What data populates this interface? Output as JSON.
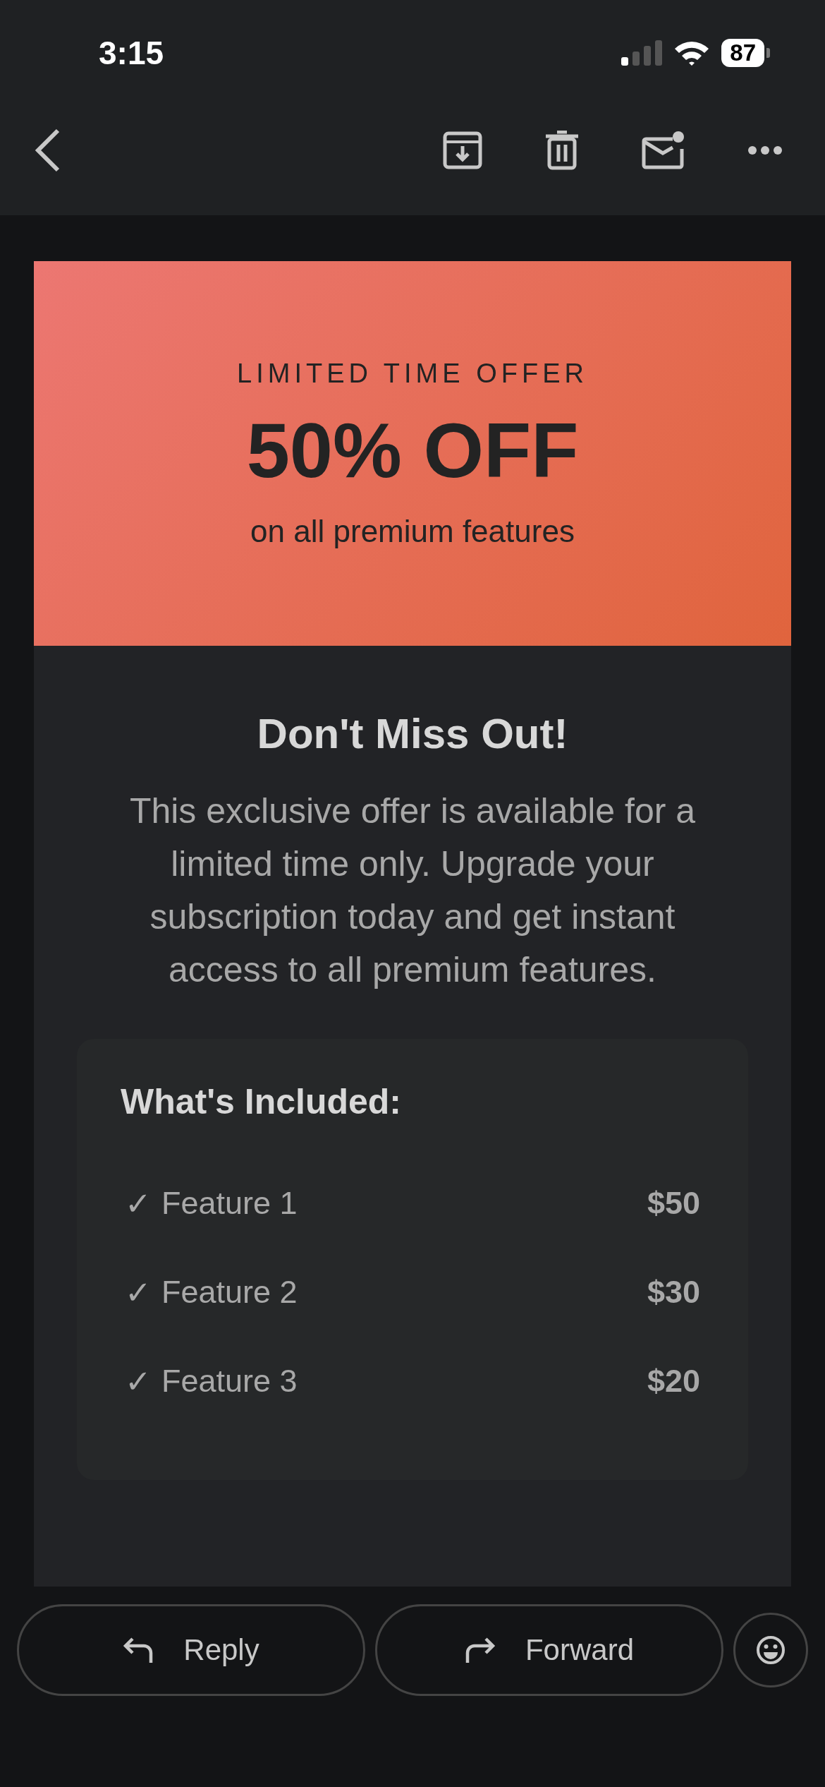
{
  "status_bar": {
    "time": "3:15",
    "battery": "87"
  },
  "toolbar": {
    "actions": [
      {
        "kind": "archive"
      },
      {
        "kind": "delete"
      },
      {
        "kind": "mark-unread"
      },
      {
        "kind": "more"
      }
    ]
  },
  "banner": {
    "eyebrow": "LIMITED TIME OFFER",
    "headline": "50% OFF",
    "subline": "on all premium features"
  },
  "body": {
    "heading": "Don't Miss Out!",
    "paragraph": "This exclusive offer is available for a limited time only. Upgrade your subscription today and get instant access to all premium features."
  },
  "included": {
    "title": "What's Included:",
    "items": [
      {
        "check": "✓",
        "name": "Feature 1",
        "price": "$50"
      },
      {
        "check": "✓",
        "name": "Feature 2",
        "price": "$30"
      },
      {
        "check": "✓",
        "name": "Feature 3",
        "price": "$20"
      }
    ]
  },
  "bottom_bar": {
    "buttons": [
      {
        "kind": "reply",
        "label": "Reply"
      },
      {
        "kind": "forward",
        "label": "Forward"
      }
    ]
  }
}
